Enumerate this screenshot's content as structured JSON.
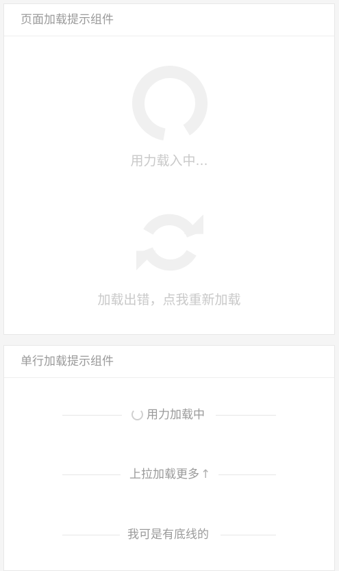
{
  "page_loading": {
    "title": "页面加载提示组件",
    "loading_text": "用力载入中...",
    "error_text": "加载出错，点我重新加载"
  },
  "line_loading": {
    "title": "单行加载提示组件",
    "rows": [
      {
        "text": "用力加载中"
      },
      {
        "text": "上拉加载更多",
        "arrow": "↑"
      },
      {
        "text": "我可是有底线的"
      }
    ]
  }
}
